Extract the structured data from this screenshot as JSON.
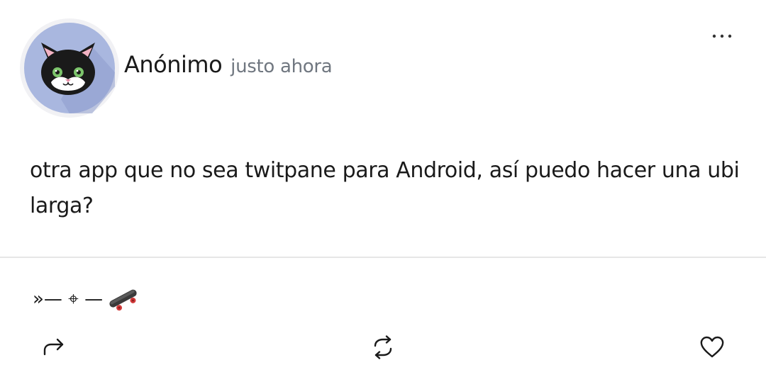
{
  "post": {
    "author": "Anónimo",
    "timestamp": "justo ahora",
    "body": "otra app que no sea twitpane para Android, así puedo hacer una ubi larga?",
    "signature": "»— ⌖ —"
  },
  "icons": {
    "avatar": "cat-avatar",
    "more": "more-dots-icon",
    "share": "share-arrow-icon",
    "repost": "repost-icon",
    "like": "heart-icon",
    "skateboard": "skateboard-emoji"
  },
  "colors": {
    "avatar_background": "#a9b7df",
    "text": "#1a1a1a",
    "timestamp": "#707780"
  }
}
